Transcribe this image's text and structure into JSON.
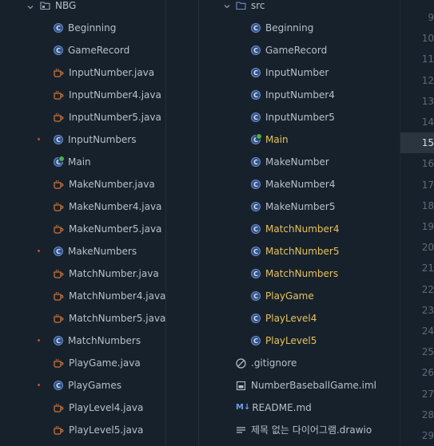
{
  "left_tree": {
    "root": {
      "label": "NBG",
      "icon": "module-folder-icon"
    },
    "items": [
      {
        "label": "Beginning",
        "kind": "class",
        "mark": false
      },
      {
        "label": "GameRecord",
        "kind": "class",
        "mark": false
      },
      {
        "label": "InputNumber.java",
        "kind": "java",
        "mark": false
      },
      {
        "label": "InputNumber4.java",
        "kind": "java",
        "mark": false
      },
      {
        "label": "InputNumber5.java",
        "kind": "java",
        "mark": false
      },
      {
        "label": "InputNumbers",
        "kind": "class",
        "mark": true
      },
      {
        "label": "Main",
        "kind": "main",
        "mark": false
      },
      {
        "label": "MakeNumber.java",
        "kind": "java",
        "mark": false
      },
      {
        "label": "MakeNumber4.java",
        "kind": "java",
        "mark": false
      },
      {
        "label": "MakeNumber5.java",
        "kind": "java",
        "mark": false
      },
      {
        "label": "MakeNumbers",
        "kind": "class",
        "mark": true
      },
      {
        "label": "MatchNumber.java",
        "kind": "java",
        "mark": false
      },
      {
        "label": "MatchNumber4.java",
        "kind": "java",
        "mark": false
      },
      {
        "label": "MatchNumber5.java",
        "kind": "java",
        "mark": false
      },
      {
        "label": "MatchNumbers",
        "kind": "class",
        "mark": true
      },
      {
        "label": "PlayGame.java",
        "kind": "java",
        "mark": false
      },
      {
        "label": "PlayGames",
        "kind": "class",
        "mark": true
      },
      {
        "label": "PlayLevel4.java",
        "kind": "java",
        "mark": false
      },
      {
        "label": "PlayLevel5.java",
        "kind": "java",
        "mark": false
      }
    ]
  },
  "middle": {
    "options_icon": "more-horizontal-icon",
    "options_glyph": "•••"
  },
  "right_tree": {
    "root": {
      "label": "src",
      "icon": "source-folder-icon"
    },
    "items": [
      {
        "label": "Beginning",
        "kind": "class",
        "modified": false
      },
      {
        "label": "GameRecord",
        "kind": "class",
        "modified": false
      },
      {
        "label": "InputNumber",
        "kind": "class",
        "modified": false
      },
      {
        "label": "InputNumber4",
        "kind": "class",
        "modified": false
      },
      {
        "label": "InputNumber5",
        "kind": "class",
        "modified": false
      },
      {
        "label": "Main",
        "kind": "main",
        "modified": true
      },
      {
        "label": "MakeNumber",
        "kind": "class",
        "modified": false
      },
      {
        "label": "MakeNumber4",
        "kind": "class",
        "modified": false
      },
      {
        "label": "MakeNumber5",
        "kind": "class",
        "modified": false
      },
      {
        "label": "MatchNumber4",
        "kind": "class",
        "modified": true
      },
      {
        "label": "MatchNumber5",
        "kind": "class",
        "modified": true
      },
      {
        "label": "MatchNumbers",
        "kind": "class",
        "modified": true
      },
      {
        "label": "PlayGame",
        "kind": "class",
        "modified": true
      },
      {
        "label": "PlayLevel4",
        "kind": "class",
        "modified": true
      },
      {
        "label": "PlayLevel5",
        "kind": "class",
        "modified": true
      }
    ],
    "files": [
      {
        "label": ".gitignore",
        "icon": "gitignore-icon"
      },
      {
        "label": "NumberBaseballGame.iml",
        "icon": "iml-file-icon"
      },
      {
        "label": "README.md",
        "icon": "markdown-icon",
        "glyph": "M↓"
      },
      {
        "label": "제목 없는 다이어그램.drawio",
        "icon": "text-file-icon"
      }
    ]
  },
  "line_numbers": {
    "values": [
      "9",
      "10",
      "11",
      "12",
      "13",
      "14",
      "15",
      "16",
      "17",
      "18",
      "19",
      "20",
      "21",
      "22",
      "23",
      "24",
      "25",
      "26",
      "27",
      "28",
      "29"
    ],
    "current": "15"
  },
  "colors": {
    "background": "#17212c",
    "text": "#b7c0ca",
    "modified_text": "#e6c25a",
    "error_dot": "#d2423a",
    "class_icon": "#2f4f86",
    "java_icon": "#c9733a"
  }
}
